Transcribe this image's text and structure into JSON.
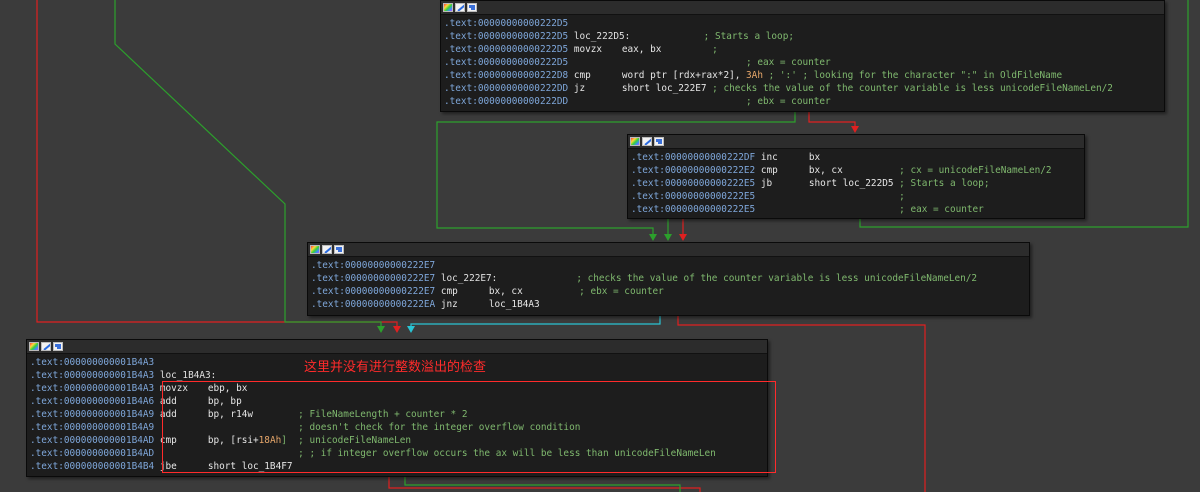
{
  "colors": {
    "background": "#3b3b3b",
    "node_bg": "#1d1d1d",
    "address": "#7ea6d9",
    "comment": "#7fb86e",
    "edge_true": "#2ca02c",
    "edge_false": "#e02020",
    "edge_uncond": "#29c4d4",
    "annotation": "#ff2b2b"
  },
  "header_icons": [
    "palette-icon",
    "pencil-icon",
    "graph-icon"
  ],
  "annotation": {
    "text": "这里并没有进行整数溢出的检查"
  },
  "nodes": [
    {
      "id": "block-222D5",
      "lines": [
        {
          "addr": ".text:00000000000222D5",
          "label": "",
          "mn": "",
          "op": "",
          "num": "",
          "cm": ""
        },
        {
          "addr": ".text:00000000000222D5",
          "label": "loc_222D5:",
          "mn": "",
          "op": "",
          "num": "",
          "cm": "             ; Starts a loop;"
        },
        {
          "addr": ".text:00000000000222D5",
          "label": "",
          "mn": "movzx",
          "op": "eax, bx        ",
          "num": "",
          "cm": " ;"
        },
        {
          "addr": ".text:00000000000222D5",
          "label": "",
          "mn": "",
          "op": "                      ",
          "num": "",
          "cm": "; eax = counter"
        },
        {
          "addr": ".text:00000000000222D8",
          "label": "",
          "mn": "cmp",
          "op": "word ptr [rdx+rax*2], ",
          "num": "3Ah",
          "cm": " ; ':' ; looking for the character \":\" in OldFileName"
        },
        {
          "addr": ".text:00000000000222DD",
          "label": "",
          "mn": "jz",
          "op": "short loc_222E7 ",
          "num": "",
          "cm": "; checks the value of the counter variable is less unicodeFileNameLen/2"
        },
        {
          "addr": ".text:00000000000222DD",
          "label": "",
          "mn": "",
          "op": "                      ",
          "num": "",
          "cm": "; ebx = counter"
        }
      ]
    },
    {
      "id": "block-222DF",
      "lines": [
        {
          "addr": ".text:00000000000222DF",
          "label": "",
          "mn": "inc",
          "op": "bx",
          "num": "",
          "cm": ""
        },
        {
          "addr": ".text:00000000000222E2",
          "label": "",
          "mn": "cmp",
          "op": "bx, cx          ",
          "num": "",
          "cm": "; cx = unicodeFileNameLen/2"
        },
        {
          "addr": ".text:00000000000222E5",
          "label": "",
          "mn": "jb",
          "op": "short loc_222D5 ",
          "num": "",
          "cm": "; Starts a loop;"
        },
        {
          "addr": ".text:00000000000222E5",
          "label": "",
          "mn": "",
          "op": "                ",
          "num": "",
          "cm": ";"
        },
        {
          "addr": ".text:00000000000222E5",
          "label": "",
          "mn": "",
          "op": "                ",
          "num": "",
          "cm": "; eax = counter"
        }
      ]
    },
    {
      "id": "block-222E7",
      "lines": [
        {
          "addr": ".text:00000000000222E7",
          "label": "",
          "mn": "",
          "op": "",
          "num": "",
          "cm": ""
        },
        {
          "addr": ".text:00000000000222E7",
          "label": "loc_222E7:",
          "mn": "",
          "op": "",
          "num": "",
          "cm": "              ; checks the value of the counter variable is less unicodeFileNameLen/2"
        },
        {
          "addr": ".text:00000000000222E7",
          "label": "",
          "mn": "cmp",
          "op": "bx, cx          ",
          "num": "",
          "cm": "; ebx = counter"
        },
        {
          "addr": ".text:00000000000222EA",
          "label": "",
          "mn": "jnz",
          "op": "loc_1B4A3",
          "num": "",
          "cm": ""
        }
      ]
    },
    {
      "id": "block-1B4A3",
      "lines": [
        {
          "addr": ".text:000000000001B4A3",
          "label": "",
          "mn": "",
          "op": "",
          "num": "",
          "cm": ""
        },
        {
          "addr": ".text:000000000001B4A3",
          "label": "loc_1B4A3:",
          "mn": "",
          "op": "",
          "num": "",
          "cm": ""
        },
        {
          "addr": ".text:000000000001B4A3",
          "label": "",
          "mn": "movzx",
          "op": "ebp, bx",
          "num": "",
          "cm": ""
        },
        {
          "addr": ".text:000000000001B4A6",
          "label": "",
          "mn": "add",
          "op": "bp, bp",
          "num": "",
          "cm": ""
        },
        {
          "addr": ".text:000000000001B4A9",
          "label": "",
          "mn": "add",
          "op": "bp, r14w        ",
          "num": "",
          "cm": "; FileNameLength + counter * 2"
        },
        {
          "addr": ".text:000000000001B4A9",
          "label": "",
          "mn": "",
          "op": "                ",
          "num": "",
          "cm": "; doesn't check for the integer overflow condition"
        },
        {
          "addr": ".text:000000000001B4AD",
          "label": "",
          "mn": "cmp",
          "op": "bp, [rsi+",
          "num": "18Ah",
          "cm": "]  ; unicodeFileNameLen"
        },
        {
          "addr": ".text:000000000001B4AD",
          "label": "",
          "mn": "",
          "op": "                ",
          "num": "",
          "cm": "; ; if integer overflow occurs the ax will be less than unicodeFileNameLen"
        },
        {
          "addr": ".text:000000000001B4B4",
          "label": "",
          "mn": "jbe",
          "op": "short loc_1B4F7",
          "num": "",
          "cm": ""
        }
      ]
    }
  ]
}
